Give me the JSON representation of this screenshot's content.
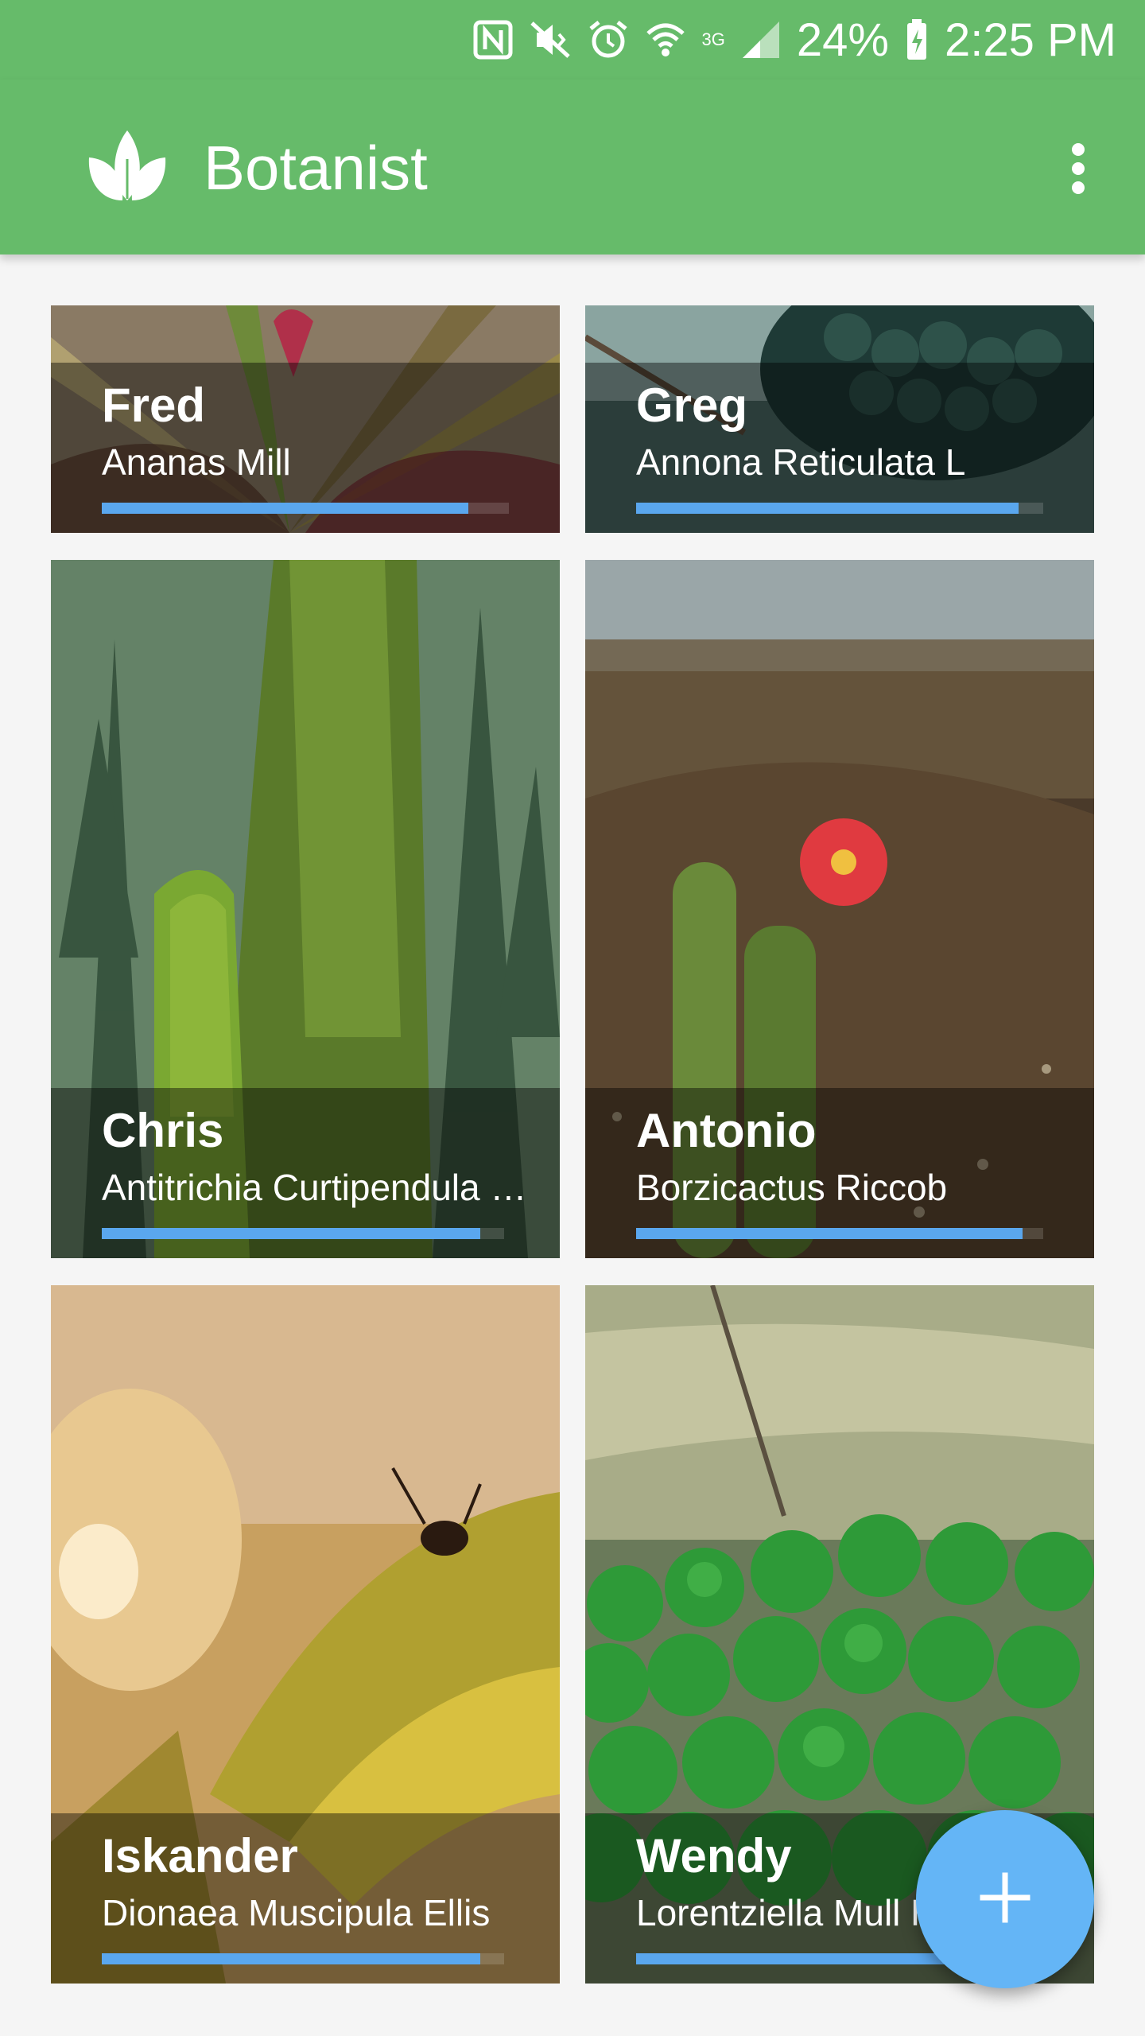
{
  "status_bar": {
    "battery": "24%",
    "time": "2:25 PM",
    "network": "3G",
    "icons": [
      "nfc-icon",
      "vibrate-icon",
      "alarm-icon",
      "wifi-icon",
      "signal-icon",
      "battery-charging-icon"
    ]
  },
  "app_bar": {
    "title": "Botanist",
    "logo_icon": "leaf-icon",
    "menu_icon": "more-vert-icon"
  },
  "plants": [
    {
      "name": "Fred",
      "species": "Ananas Mill",
      "progress": 0.9,
      "accent": "#5aa7ee"
    },
    {
      "name": "Greg",
      "species": "Annona Reticulata L",
      "progress": 0.94,
      "accent": "#5aa7ee"
    },
    {
      "name": "Chris",
      "species": "Antitrichia Curtipendula <…",
      "progress": 0.94,
      "accent": "#5aa7ee"
    },
    {
      "name": "Antonio",
      "species": "Borzicactus Riccob",
      "progress": 0.95,
      "accent": "#5aa7ee"
    },
    {
      "name": "Iskander",
      "species": "Dionaea Muscipula Ellis",
      "progress": 0.94,
      "accent": "#5aa7ee"
    },
    {
      "name": "Wendy",
      "species": "Lorentziella Mull H",
      "progress": 0.94,
      "accent": "#5aa7ee"
    }
  ],
  "fab": {
    "icon": "plus-icon",
    "color": "#64b5f6"
  },
  "colors": {
    "primary": "#66bb6a",
    "accent": "#64b5f6",
    "progress": "#5aa7ee"
  }
}
